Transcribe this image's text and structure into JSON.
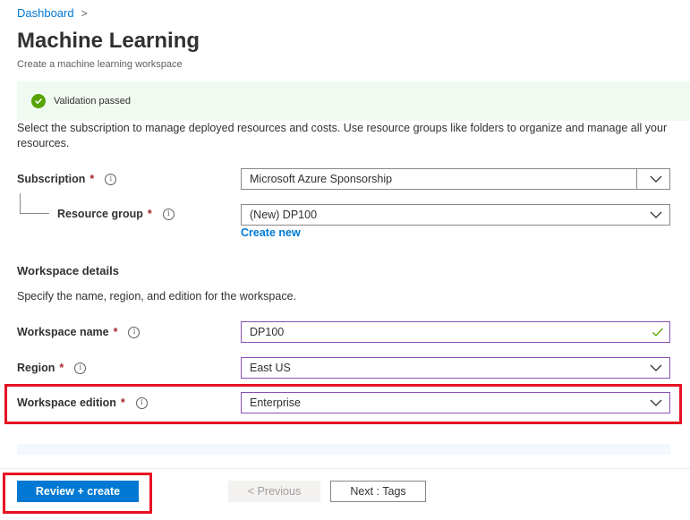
{
  "breadcrumb": {
    "items": [
      "Dashboard"
    ],
    "chevron": ">"
  },
  "header": {
    "title": "Machine Learning",
    "subtitle": "Create a machine learning workspace"
  },
  "validation": {
    "message": "Validation passed",
    "status_color": "#57a300",
    "icon": "check-circle-icon"
  },
  "project_details": {
    "description": "Select the subscription to manage deployed resources and costs. Use resource groups like folders to organize and manage all your resources.",
    "subscription": {
      "label": "Subscription",
      "required_mark": "*",
      "value": "Microsoft Azure Sponsorship"
    },
    "resource_group": {
      "label": "Resource group",
      "required_mark": "*",
      "value": "(New) DP100",
      "create_new_link": "Create new"
    }
  },
  "workspace_details": {
    "title": "Workspace details",
    "description": "Specify the name, region, and edition for the workspace.",
    "workspace_name": {
      "label": "Workspace name",
      "required_mark": "*",
      "value": "DP100"
    },
    "region": {
      "label": "Region",
      "required_mark": "*",
      "value": "East US"
    },
    "edition": {
      "label": "Workspace edition",
      "required_mark": "*",
      "value": "Enterprise"
    }
  },
  "footer": {
    "review_create_label": "Review + create",
    "previous_label": "< Previous",
    "next_label": "Next : Tags"
  },
  "colors": {
    "accent": "#0078d4",
    "highlight": "#e81123",
    "required": "#a4262c",
    "valid_check": "#57a300"
  }
}
